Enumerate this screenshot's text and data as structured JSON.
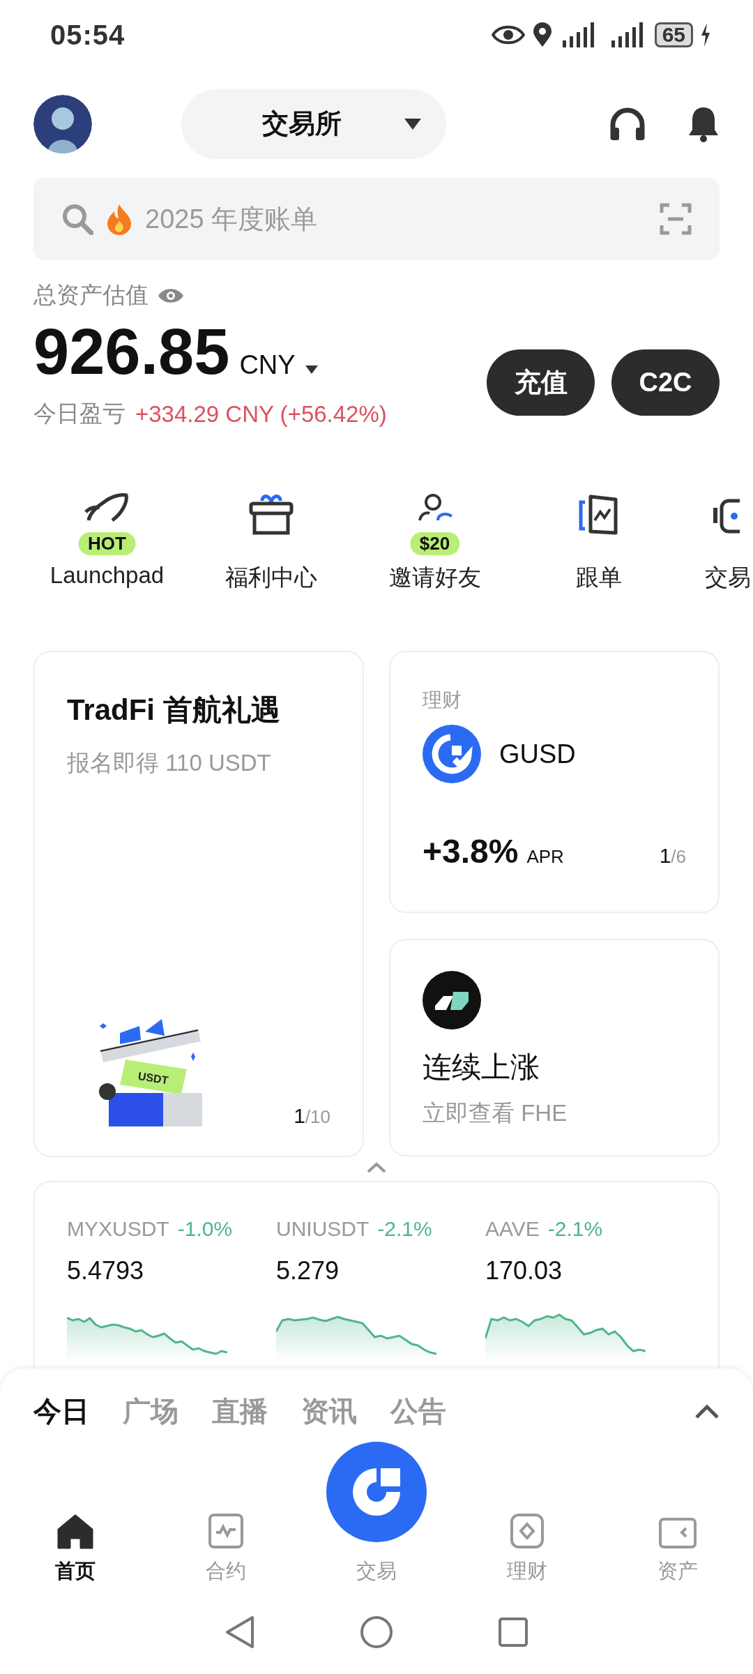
{
  "status_bar": {
    "time": "05:54",
    "battery": "65"
  },
  "header": {
    "title": "交易所"
  },
  "search": {
    "placeholder": "2025 年度账单"
  },
  "assets": {
    "label": "总资产估值",
    "amount": "926.85",
    "currency": "CNY",
    "pnl_label": "今日盈亏",
    "pnl": "+334.29 CNY (+56.42%)",
    "buttons": [
      "充值",
      "C2C"
    ]
  },
  "shortcuts": [
    {
      "label": "Launchpad",
      "badge": "HOT",
      "kind": "rocket"
    },
    {
      "label": "福利中心",
      "kind": "gift"
    },
    {
      "label": "邀请好友",
      "badge": "$20",
      "kind": "invite"
    },
    {
      "label": "跟单",
      "kind": "copy"
    },
    {
      "label": "交易",
      "kind": "bot"
    }
  ],
  "promo": {
    "title": "TradFi 首航礼遇",
    "subtitle": "报名即得 110 USDT",
    "ticket_label": "USDT",
    "current": "1",
    "rest": "/10"
  },
  "earn": {
    "tag": "理财",
    "name": "GUSD",
    "rate": "+3.8%",
    "unit": "APR",
    "current": "1",
    "rest": "/6"
  },
  "trend": {
    "title": "连续上涨",
    "subtitle": "立即查看 FHE"
  },
  "tickers": [
    {
      "symbol": "MYXUSDT",
      "change": "-1.0%",
      "price": "5.4793"
    },
    {
      "symbol": "UNIUSDT",
      "change": "-2.1%",
      "price": "5.279"
    },
    {
      "symbol": "AAVE",
      "change": "-2.1%",
      "price": "170.03"
    }
  ],
  "feed_tabs": [
    {
      "label": "今日",
      "selected": true
    },
    {
      "label": "广场",
      "selected": false
    },
    {
      "label": "直播",
      "selected": false
    },
    {
      "label": "资讯",
      "selected": false
    },
    {
      "label": "公告",
      "selected": false
    }
  ],
  "nav": [
    {
      "label": "首页",
      "kind": "home",
      "selected": true
    },
    {
      "label": "合约",
      "kind": "futures",
      "selected": false
    },
    {
      "label": "交易",
      "kind": "trade",
      "selected": false
    },
    {
      "label": "理财",
      "kind": "earn",
      "selected": false
    },
    {
      "label": "资产",
      "kind": "assets",
      "selected": false
    }
  ]
}
